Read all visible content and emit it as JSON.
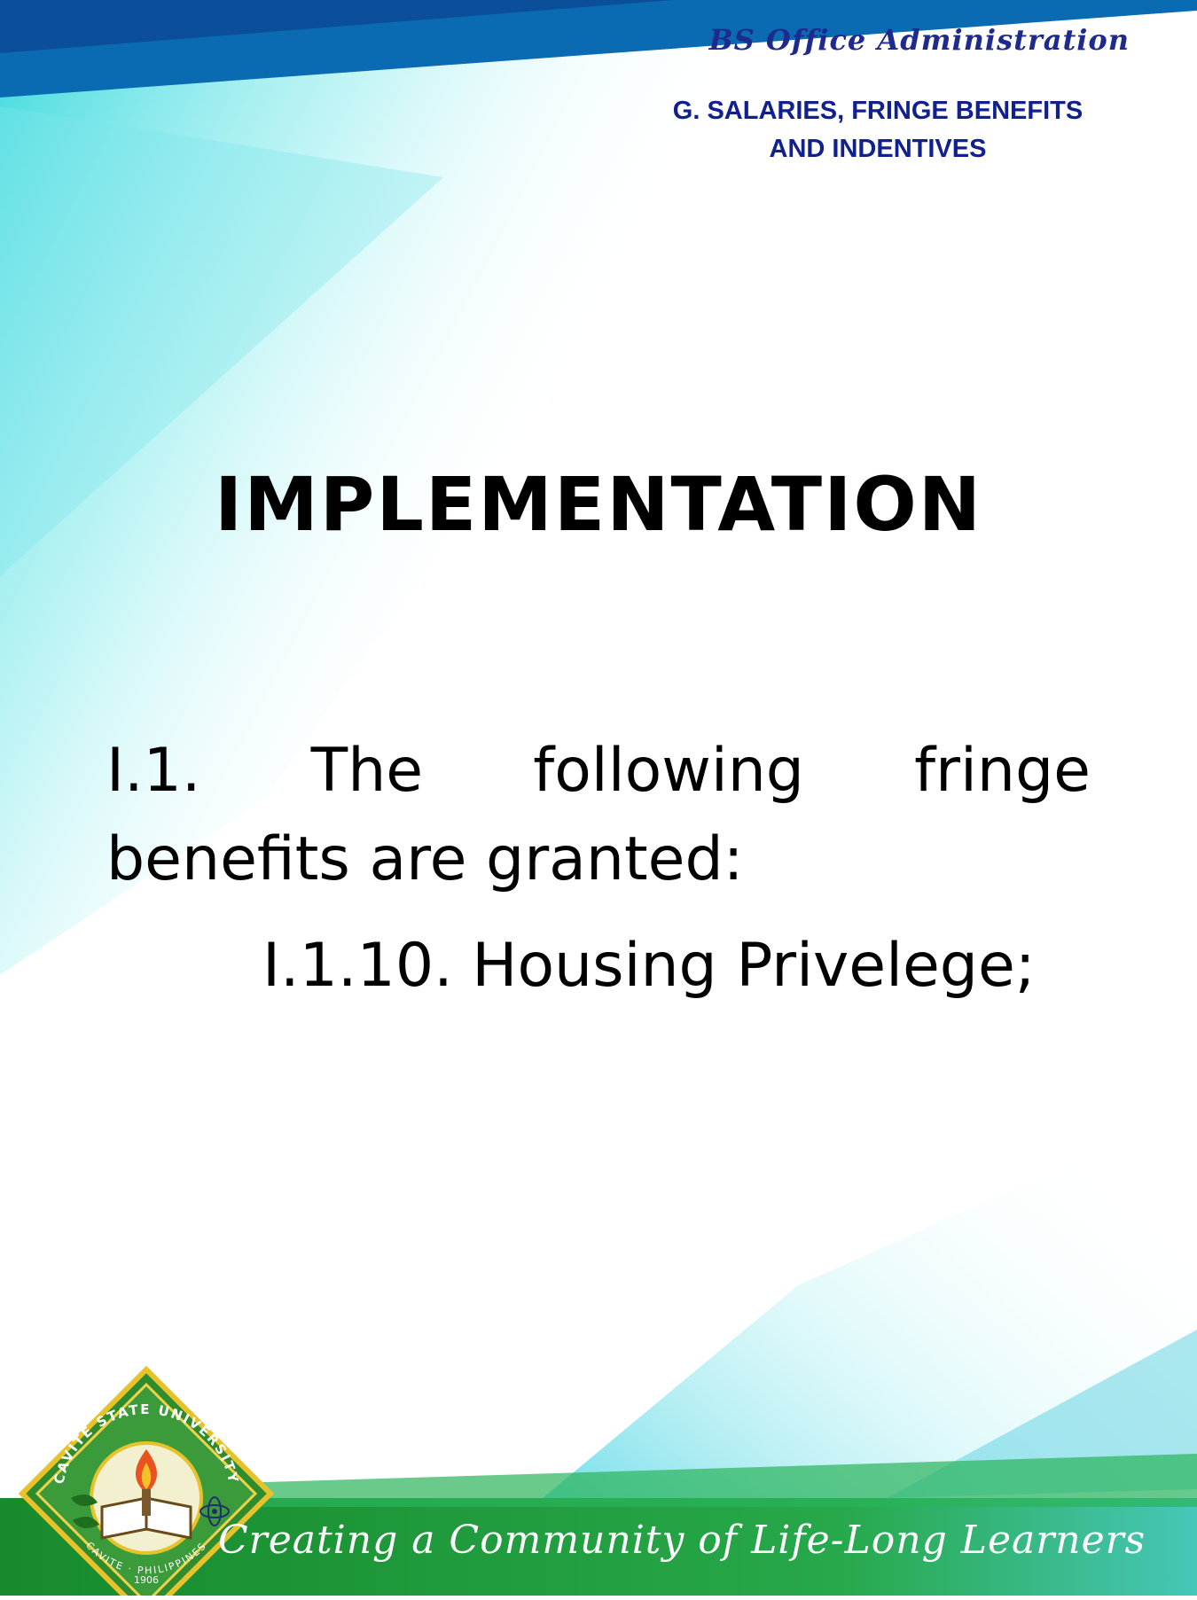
{
  "header": {
    "program_title": "BS Office Administration",
    "section_title_line1": "G. SALARIES, FRINGE BENEFITS",
    "section_title_line2": "AND INDENTIVES"
  },
  "main": {
    "heading": "IMPLEMENTATION",
    "clause": {
      "number": "I.1.",
      "words": [
        "The",
        "following",
        "fringe"
      ],
      "continuation": "benefits are granted:"
    },
    "subclause": "I.1.10. Housing Privelege;"
  },
  "footer": {
    "motto": "Creating a Community of Life-Long Learners",
    "seal": {
      "top_text": "CAVITE STATE UNIVERSITY",
      "bottom_text": "CAVITE · PHILIPPINES",
      "year": "1906"
    }
  },
  "colors": {
    "accent_blue": "#1e2a8c",
    "top_band": "#0a6bb3",
    "bottom_band": "#1e9a3c",
    "teal": "#3ed6d6"
  }
}
